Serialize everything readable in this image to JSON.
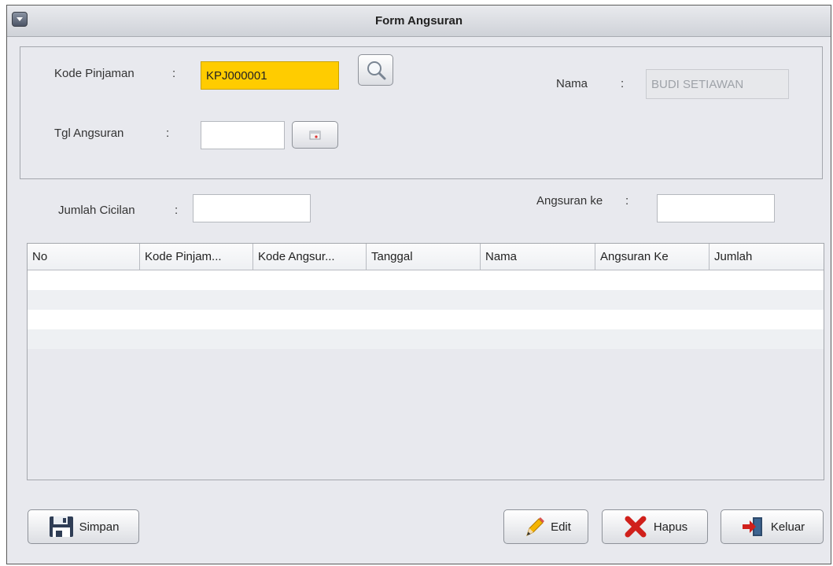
{
  "window": {
    "title": "Form Angsuran"
  },
  "form": {
    "kode_pinjaman_label": "Kode Pinjaman",
    "kode_pinjaman_value": "KPJ000001",
    "nama_label": "Nama",
    "nama_value": "BUDI SETIAWAN",
    "tgl_angsuran_label": "Tgl Angsuran",
    "tgl_angsuran_value": "",
    "jumlah_cicilan_label": "Jumlah Cicilan",
    "jumlah_cicilan_value": "",
    "angsuran_ke_label": "Angsuran ke",
    "angsuran_ke_value": "",
    "colon": ":"
  },
  "table": {
    "columns": [
      "No",
      "Kode Pinjam...",
      "Kode Angsur...",
      "Tanggal",
      "Nama",
      "Angsuran Ke",
      "Jumlah"
    ],
    "rows": []
  },
  "buttons": {
    "simpan": "Simpan",
    "edit": "Edit",
    "hapus": "Hapus",
    "keluar": "Keluar"
  },
  "icons": {
    "search": "magnifier-icon",
    "calendar": "calendar-icon",
    "save": "floppy-disk-icon",
    "edit": "pencil-icon",
    "delete": "red-x-icon",
    "exit": "exit-door-icon"
  }
}
